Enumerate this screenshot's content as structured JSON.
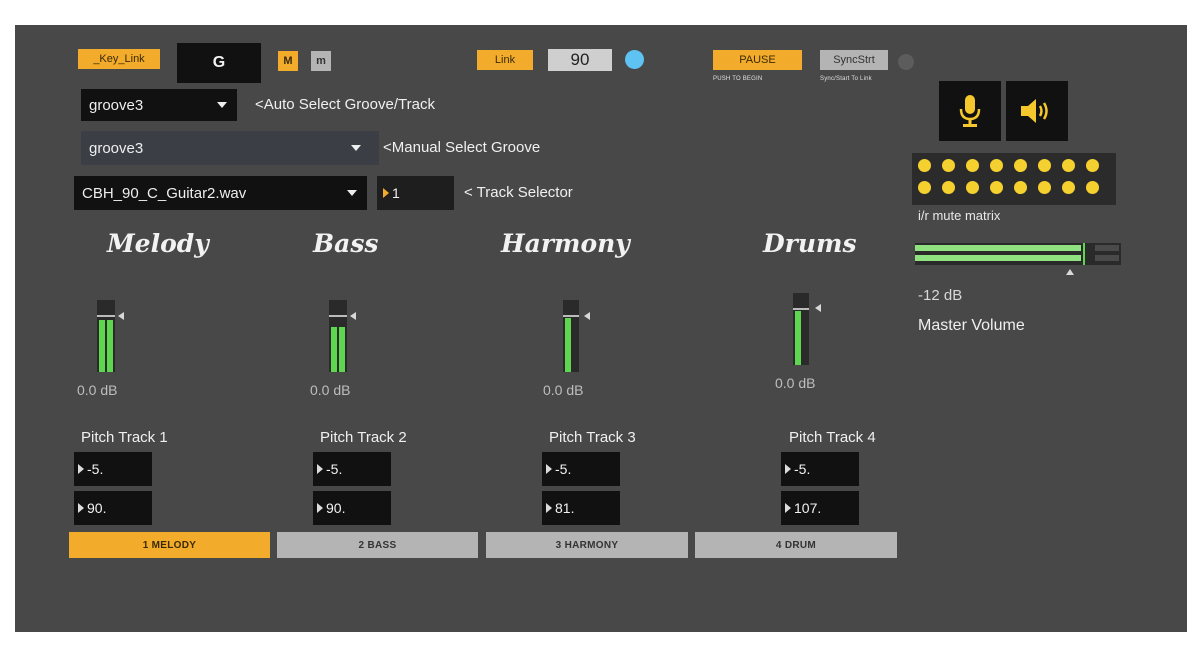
{
  "top_bar": {
    "key_link_label": "_Key_Link",
    "key_value": "G",
    "major_label": "M",
    "minor_label": "m",
    "link_label": "Link",
    "tempo_value": "90",
    "pause_label": "PAUSE",
    "pause_caption": "PUSH TO BEGIN",
    "sync_label": "SyncStrt",
    "sync_caption": "Sync/Start To Link"
  },
  "selectors": {
    "auto_groove_value": "groove3",
    "auto_groove_label": "<Auto Select Groove/Track",
    "manual_groove_value": "groove3",
    "manual_groove_label": "<Manual Select Groove",
    "file_value": "CBH_90_C_Guitar2.wav",
    "track_number_value": "1",
    "track_selector_label": "< Track Selector"
  },
  "channels": [
    {
      "title": "Melody",
      "db": "0.0 dB",
      "pitch_label": "Pitch Track 1",
      "transpose": "-5.",
      "tempo": "90.",
      "button": "1 MELODY",
      "active": true,
      "meter_level": 0.75
    },
    {
      "title": "Bass",
      "db": "0.0 dB",
      "pitch_label": "Pitch Track 2",
      "transpose": "-5.",
      "tempo": "90.",
      "button": "2 BASS",
      "active": false,
      "meter_level": 0.7
    },
    {
      "title": "Harmony",
      "db": "0.0 dB",
      "pitch_label": "Pitch Track 3",
      "transpose": "-5.",
      "tempo": "81.",
      "button": "3 HARMONY",
      "active": false,
      "meter_level": 0.78
    },
    {
      "title": "Drums",
      "db": "0.0 dB",
      "pitch_label": "Pitch Track 4",
      "transpose": "-5.",
      "tempo": "107.",
      "button": "4 DRUM",
      "active": false,
      "meter_level": 0.78
    }
  ],
  "right_panel": {
    "mic_icon": "microphone-icon",
    "speaker_icon": "speaker-icon",
    "mute_matrix_label": "i/r mute matrix",
    "master_db": "-12 dB",
    "master_label": "Master Volume",
    "master_level": 0.82
  },
  "colors": {
    "accent": "#f2ab2a",
    "panel": "#484848",
    "meter": "#5fd64f",
    "led": "#5ec3f2",
    "dot": "#f5d130"
  }
}
